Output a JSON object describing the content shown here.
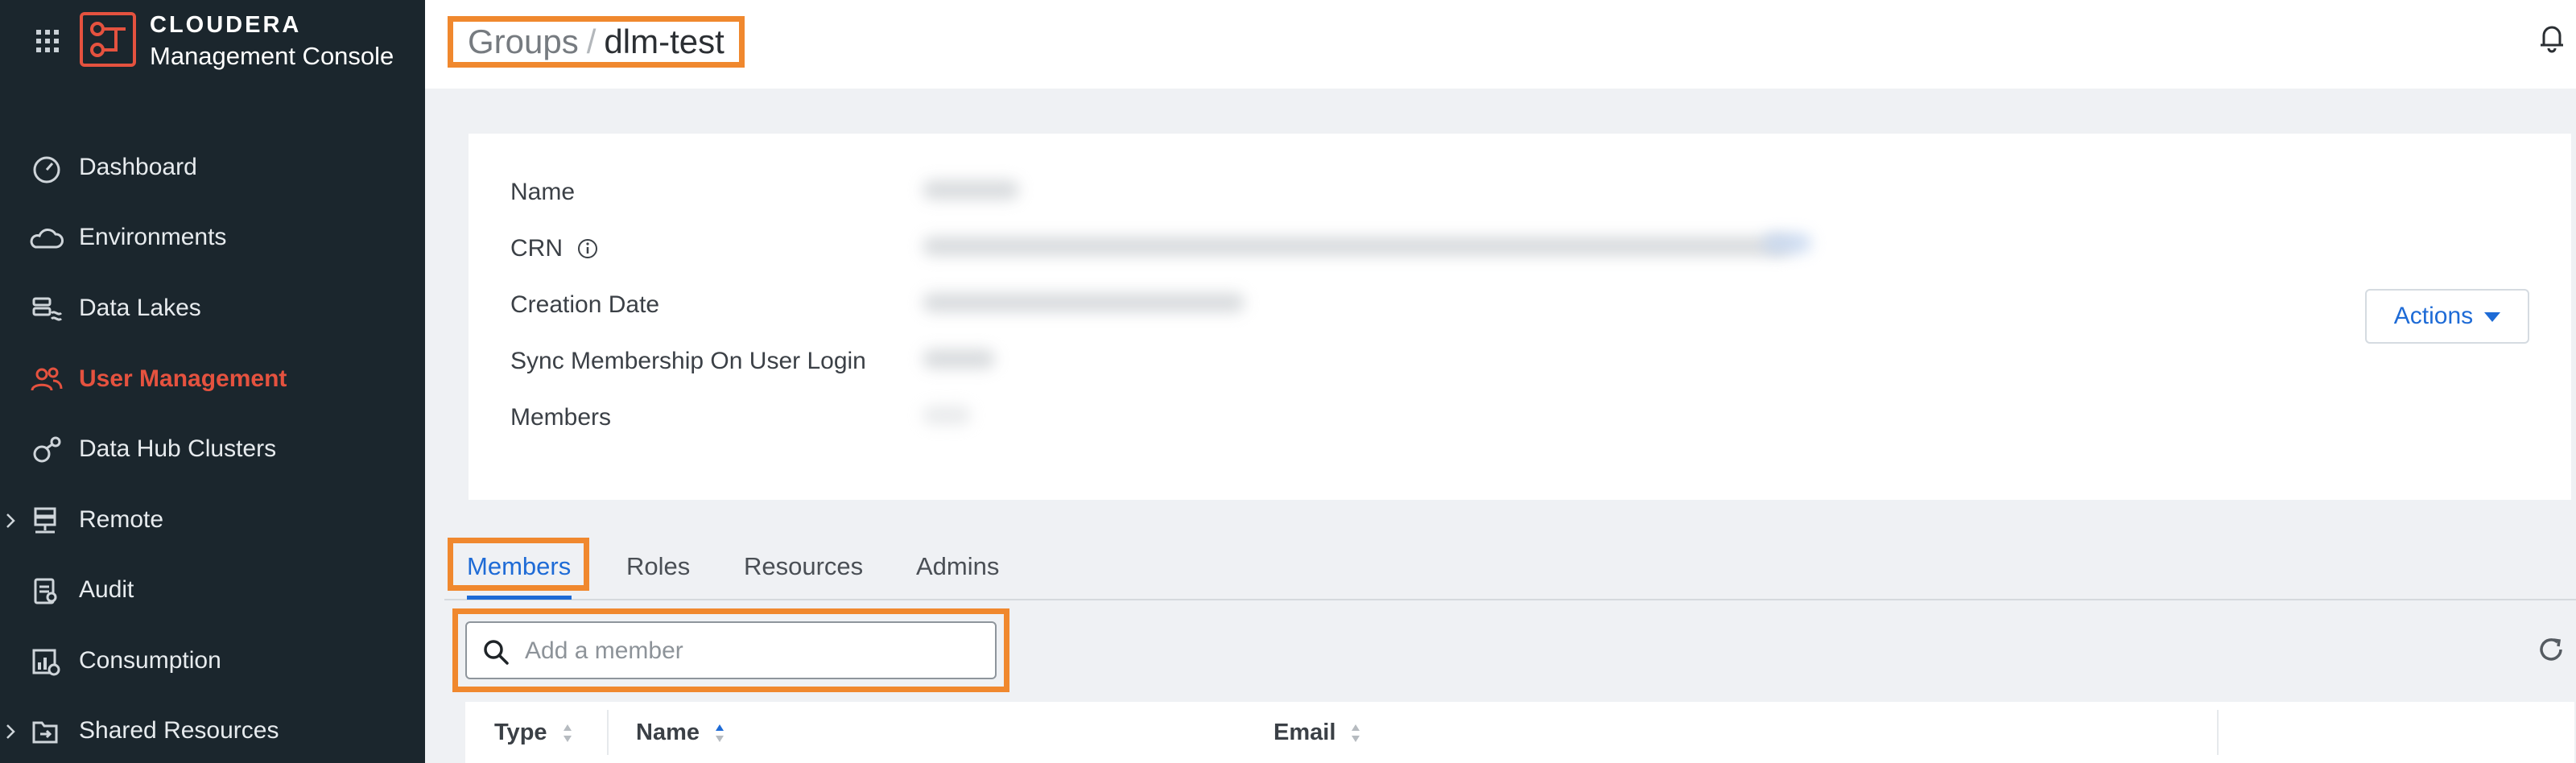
{
  "brand": {
    "line1": "CLOUDERA",
    "line2": "Management Console",
    "accent": "#e5523f"
  },
  "nav": [
    {
      "label": "Dashboard",
      "icon": "dashboard-gauge-icon",
      "active": false
    },
    {
      "label": "Environments",
      "icon": "cloud-icon",
      "active": false
    },
    {
      "label": "Data Lakes",
      "icon": "data-lake-icon",
      "active": false
    },
    {
      "label": "User Management",
      "icon": "users-icon",
      "active": true
    },
    {
      "label": "Data Hub Clusters",
      "icon": "clusters-icon",
      "active": false
    },
    {
      "label": "Remote",
      "icon": "remote-server-icon",
      "active": false,
      "expandable": true
    },
    {
      "label": "Audit",
      "icon": "audit-clipboard-icon",
      "active": false
    },
    {
      "label": "Consumption",
      "icon": "consumption-chart-icon",
      "active": false
    },
    {
      "label": "Shared Resources",
      "icon": "shared-resources-icon",
      "active": false,
      "expandable": true
    }
  ],
  "breadcrumb": {
    "root": "Groups",
    "separator": "/",
    "current": "dlm-test"
  },
  "details": {
    "labels": [
      "Name",
      "CRN",
      "Creation Date",
      "Sync Membership On User Login",
      "Members"
    ],
    "actions_label": "Actions"
  },
  "tabs": [
    "Members",
    "Roles",
    "Resources",
    "Admins"
  ],
  "active_tab": "Members",
  "search": {
    "placeholder": "Add a member",
    "value": ""
  },
  "table": {
    "columns": [
      "Type",
      "Name",
      "Email"
    ],
    "sorted_column": "Name"
  },
  "colors": {
    "highlight": "#f0882e",
    "link": "#1e6bd6",
    "sidebar": "#1b262d"
  }
}
